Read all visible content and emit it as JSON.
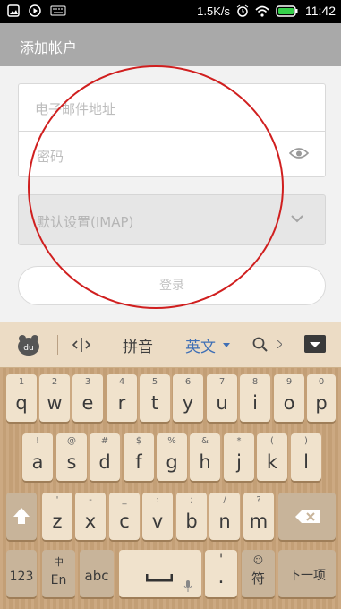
{
  "status_bar": {
    "net_speed": "1.5K/s",
    "time": "11:42"
  },
  "app_bar": {
    "title": "添加帐户"
  },
  "form": {
    "email_placeholder": "电子邮件地址",
    "password_placeholder": "密码",
    "server_setting": "默认设置(IMAP)",
    "login_label": "登录"
  },
  "keyboard": {
    "toolbar": {
      "pinyin": "拼音",
      "english": "英文"
    },
    "row1": [
      {
        "m": "q",
        "s": "1"
      },
      {
        "m": "w",
        "s": "2"
      },
      {
        "m": "e",
        "s": "3"
      },
      {
        "m": "r",
        "s": "4"
      },
      {
        "m": "t",
        "s": "5"
      },
      {
        "m": "y",
        "s": "6"
      },
      {
        "m": "u",
        "s": "7"
      },
      {
        "m": "i",
        "s": "8"
      },
      {
        "m": "o",
        "s": "9"
      },
      {
        "m": "p",
        "s": "0"
      }
    ],
    "row2": [
      {
        "m": "a",
        "s": "!"
      },
      {
        "m": "s",
        "s": "@"
      },
      {
        "m": "d",
        "s": "#"
      },
      {
        "m": "f",
        "s": "$"
      },
      {
        "m": "g",
        "s": "%"
      },
      {
        "m": "h",
        "s": "&"
      },
      {
        "m": "j",
        "s": "*"
      },
      {
        "m": "k",
        "s": "("
      },
      {
        "m": "l",
        "s": ")"
      }
    ],
    "row3": [
      {
        "m": "z",
        "s": "'"
      },
      {
        "m": "x",
        "s": "-"
      },
      {
        "m": "c",
        "s": "_"
      },
      {
        "m": "v",
        "s": ":"
      },
      {
        "m": "b",
        "s": ";"
      },
      {
        "m": "n",
        "s": "/"
      },
      {
        "m": "m",
        "s": "?"
      }
    ],
    "row4": {
      "num": "123",
      "lang_top": "中",
      "lang_bottom": "En",
      "abc": "abc",
      "punct_top": "'",
      "punct_bottom": ".",
      "symbol_top": "☺",
      "symbol": "符",
      "next": "下一项"
    }
  },
  "colors": {
    "annotation_circle": "#d01f1f",
    "app_bar": "#a9a9a9",
    "english_accent": "#3f6fb5"
  }
}
